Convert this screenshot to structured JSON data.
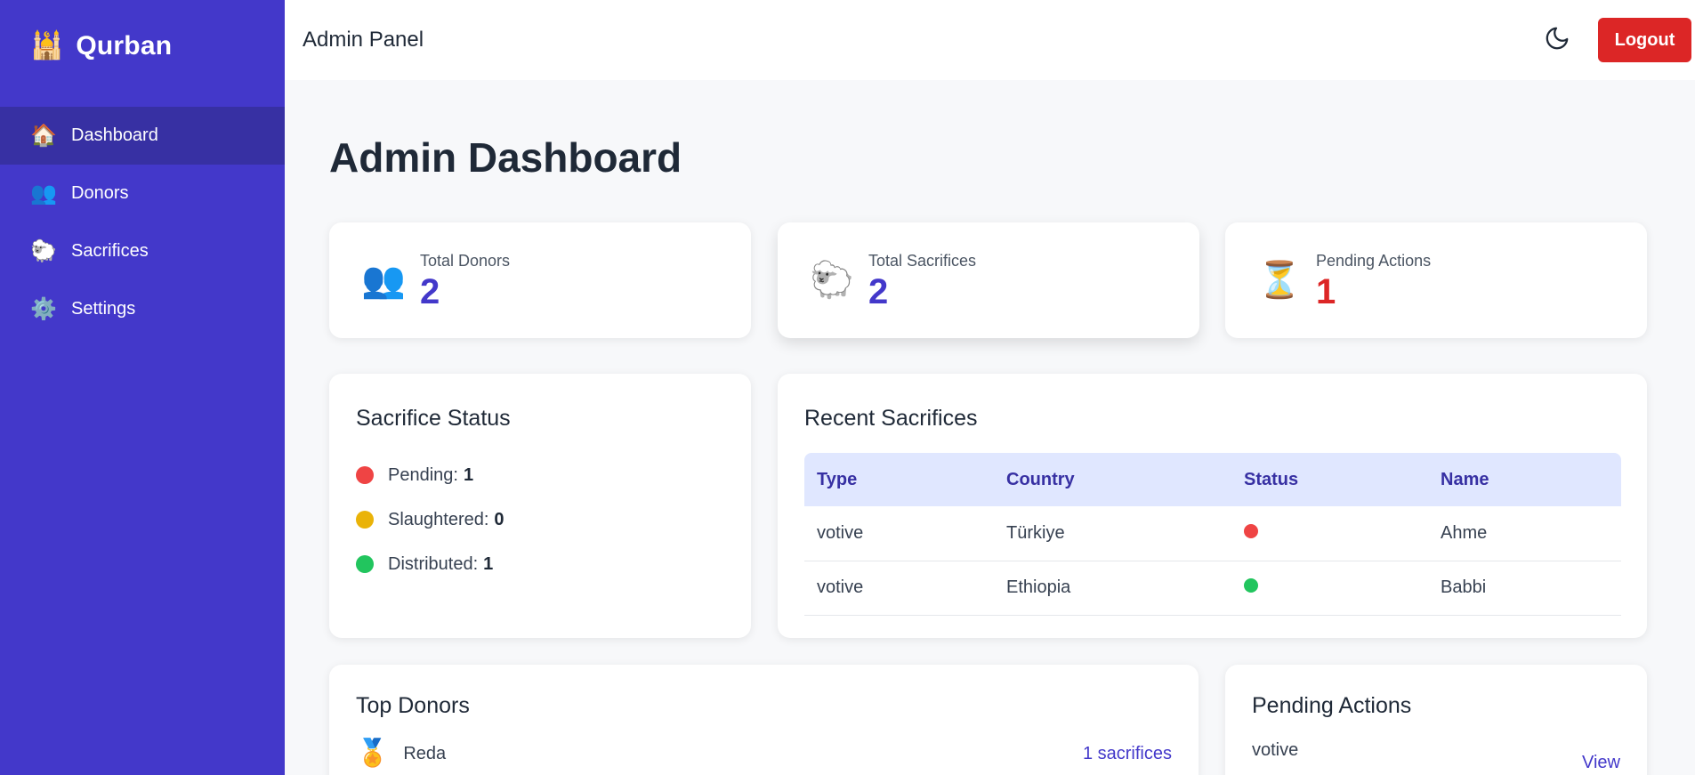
{
  "brand": {
    "name": "Qurban",
    "icon": "🕌"
  },
  "sidebar": {
    "items": [
      {
        "label": "Dashboard",
        "icon": "🏠",
        "active": true
      },
      {
        "label": "Donors",
        "icon": "👥",
        "active": false
      },
      {
        "label": "Sacrifices",
        "icon": "🐑",
        "active": false
      },
      {
        "label": "Settings",
        "icon": "⚙️",
        "active": false
      }
    ]
  },
  "header": {
    "title": "Admin Panel",
    "logout_label": "Logout",
    "theme_icon": "moon-icon"
  },
  "page": {
    "title": "Admin Dashboard"
  },
  "stats": [
    {
      "label": "Total Donors",
      "value": "2",
      "icon": "👥",
      "color": "#4338ca"
    },
    {
      "label": "Total Sacrifices",
      "value": "2",
      "icon": "🐑",
      "color": "#4338ca"
    },
    {
      "label": "Pending Actions",
      "value": "1",
      "icon": "⏳",
      "color": "#dc2626"
    }
  ],
  "sacrifice_status": {
    "title": "Sacrifice Status",
    "items": [
      {
        "label": "Pending:",
        "value": "1",
        "color": "#ef4444"
      },
      {
        "label": "Slaughtered:",
        "value": "0",
        "color": "#eab308"
      },
      {
        "label": "Distributed:",
        "value": "1",
        "color": "#22c55e"
      }
    ]
  },
  "recent_sacrifices": {
    "title": "Recent Sacrifices",
    "columns": [
      "Type",
      "Country",
      "Status",
      "Name"
    ],
    "rows": [
      {
        "type": "votive",
        "country": "Türkiye",
        "status_color": "#ef4444",
        "name": "Ahme"
      },
      {
        "type": "votive",
        "country": "Ethiopia",
        "status_color": "#22c55e",
        "name": "Babbi"
      }
    ]
  },
  "top_donors": {
    "title": "Top Donors",
    "items": [
      {
        "medal": "🏅",
        "name": "Reda",
        "count": "1 sacrifices"
      }
    ]
  },
  "pending_actions": {
    "title": "Pending Actions",
    "items": [
      {
        "type": "votive",
        "action_label": "View"
      }
    ]
  }
}
